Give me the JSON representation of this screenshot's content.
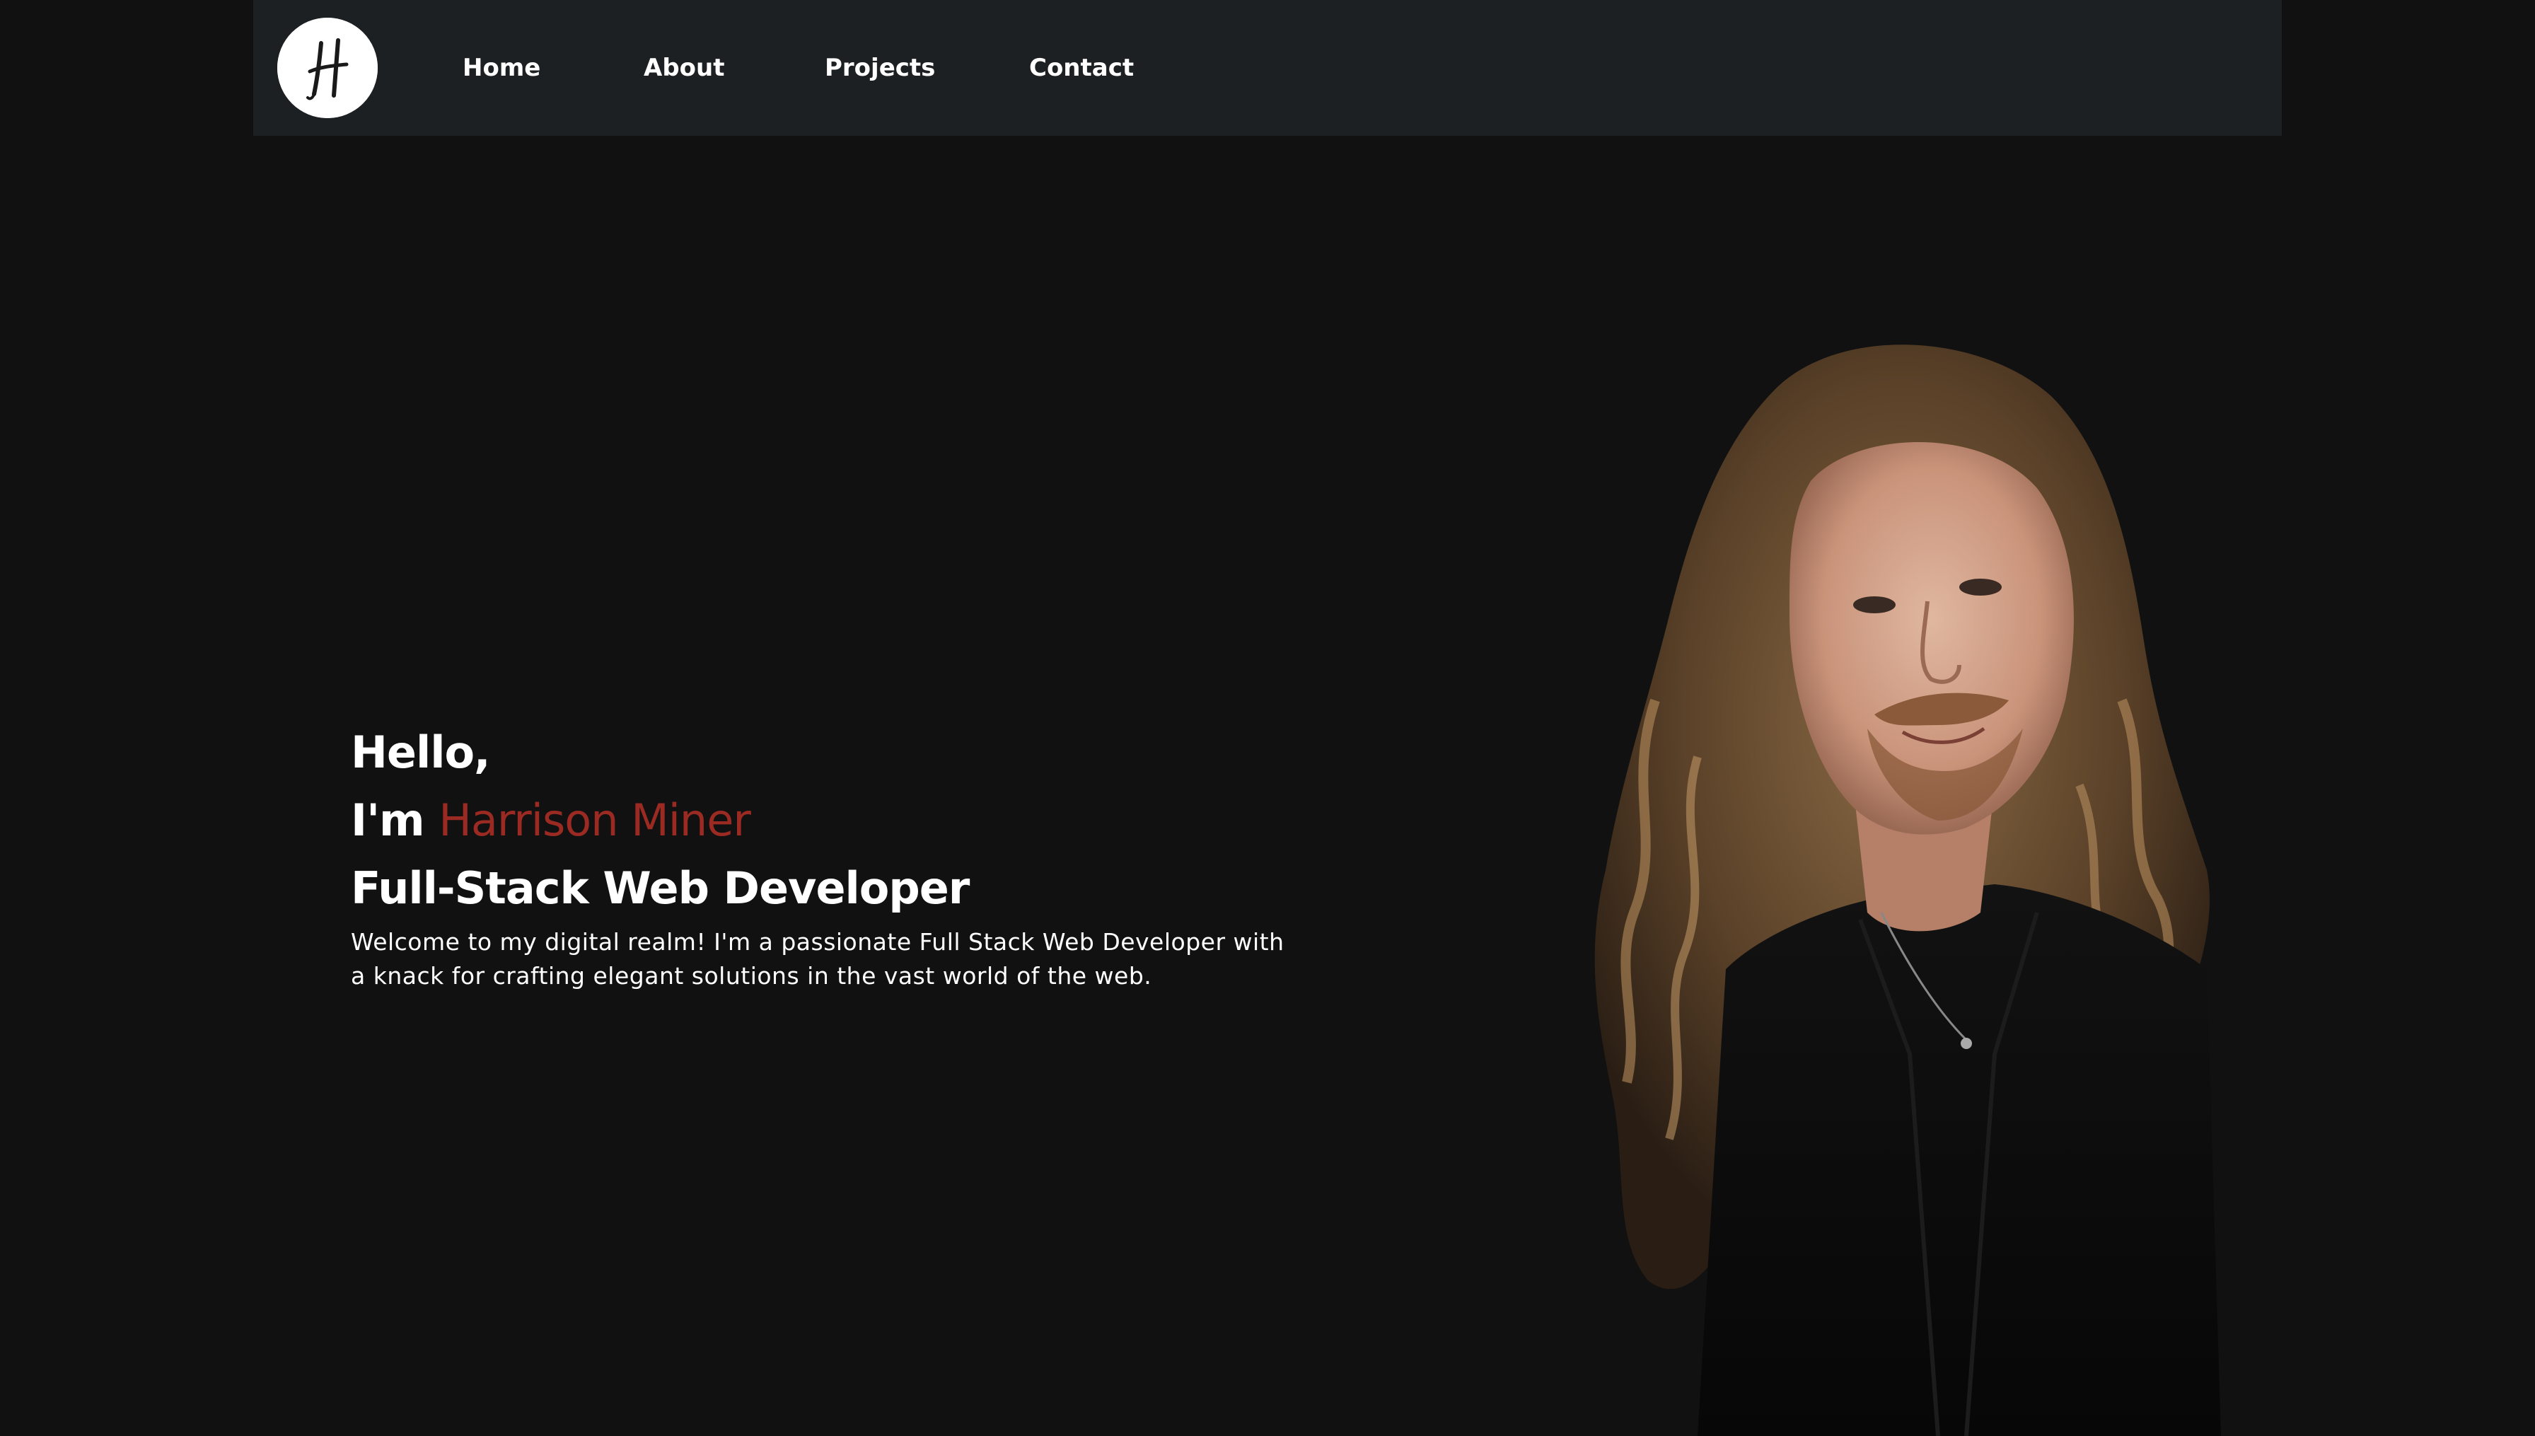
{
  "nav": {
    "logo_letter": "H",
    "items": [
      {
        "label": "Home"
      },
      {
        "label": "About"
      },
      {
        "label": "Projects"
      },
      {
        "label": "Contact"
      }
    ]
  },
  "hero": {
    "greeting": "Hello,",
    "intro_prefix": "I'm",
    "name": "Harrison Miner",
    "role": "Full-Stack Web Developer",
    "welcome": "Welcome to my digital realm! I'm a passionate Full Stack Web Developer with a knack for crafting elegant solutions in the vast world of the web."
  },
  "colors": {
    "background": "#111111",
    "navbar": "#1d2022",
    "accent_name": "#9b2a22",
    "text": "#ffffff"
  },
  "icons": {
    "logo": "handwritten-h-logo-icon",
    "portrait": "profile-photo"
  }
}
